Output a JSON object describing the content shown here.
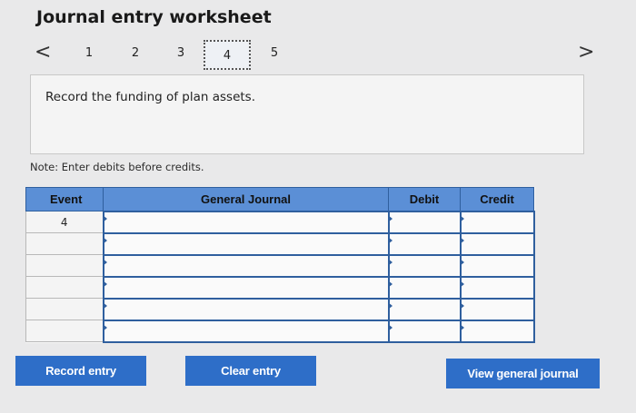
{
  "header": {
    "title": "Journal entry worksheet"
  },
  "pager": {
    "prev": "<",
    "next": ">",
    "pages": [
      "1",
      "2",
      "3",
      "4",
      "5"
    ],
    "active": "4"
  },
  "instruction": {
    "text": "Record the funding of plan assets."
  },
  "note": {
    "text": "Note: Enter debits before credits."
  },
  "table": {
    "columns": [
      "Event",
      "General Journal",
      "Debit",
      "Credit"
    ],
    "rows": [
      {
        "event": "4",
        "account": "",
        "debit": "",
        "credit": ""
      },
      {
        "event": "",
        "account": "",
        "debit": "",
        "credit": ""
      },
      {
        "event": "",
        "account": "",
        "debit": "",
        "credit": ""
      },
      {
        "event": "",
        "account": "",
        "debit": "",
        "credit": ""
      },
      {
        "event": "",
        "account": "",
        "debit": "",
        "credit": ""
      },
      {
        "event": "",
        "account": "",
        "debit": "",
        "credit": ""
      }
    ]
  },
  "buttons": {
    "record": "Record entry",
    "clear": "Clear entry",
    "view": "View general journal"
  },
  "colors": {
    "accent": "#2e6ec8",
    "header_bg": "#5b8fd6",
    "input_border": "#2f5f9e",
    "page_bg": "#e9e9ea"
  }
}
